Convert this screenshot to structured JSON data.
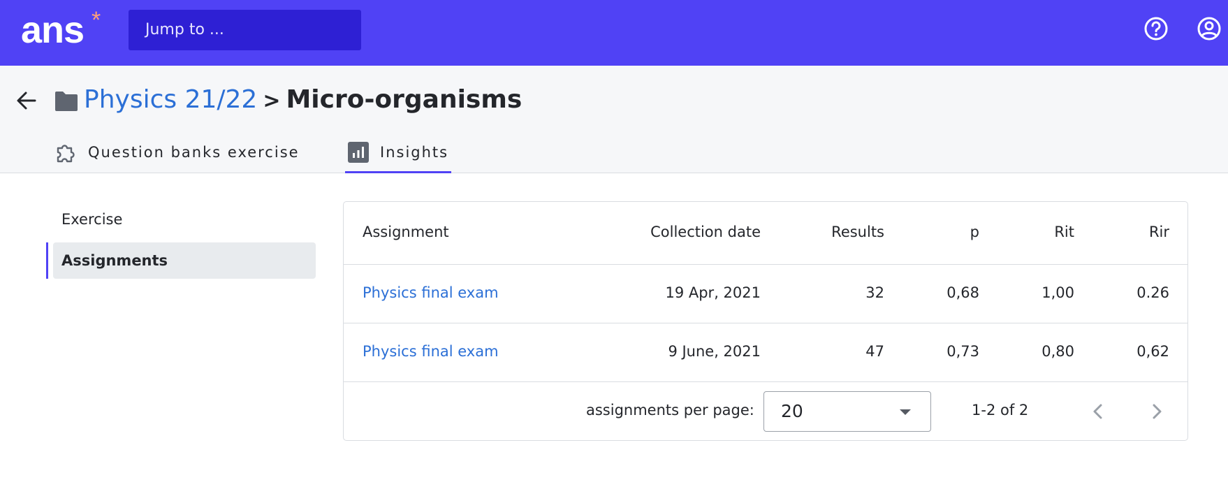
{
  "topbar": {
    "logo_text": "ans",
    "logo_star": "*",
    "search_placeholder": "Jump to ...",
    "icons": [
      "help-icon",
      "account-icon"
    ],
    "bg_color": "#5042f5"
  },
  "header": {
    "breadcrumb_parent": "Physics 21/22",
    "breadcrumb_separator": ">",
    "page_title": "Micro-organisms",
    "tabs": [
      {
        "label": "Question banks exercise",
        "icon": "puzzle-icon",
        "active": false
      },
      {
        "label": "Insights",
        "icon": "chart-icon",
        "active": true
      }
    ]
  },
  "sidebar": {
    "items": [
      {
        "label": "Exercise",
        "active": false
      },
      {
        "label": "Assignments",
        "active": true
      }
    ]
  },
  "table": {
    "columns": [
      "Assignment",
      "Collection date",
      "Results",
      "p",
      "Rit",
      "Rir"
    ],
    "rows": [
      [
        "Physics final exam",
        "19 Apr, 2021",
        "32",
        "0,68",
        "1,00",
        "0.26"
      ],
      [
        "Physics final exam",
        "9 June, 2021",
        "47",
        "0,73",
        "0,80",
        "0,62"
      ]
    ],
    "footer": {
      "per_page_label": "assignments per page:",
      "per_page_value": "20",
      "range_text": "1-2 of 2"
    }
  },
  "colors": {
    "accent": "#5042f5",
    "link": "#2b6fd6"
  }
}
